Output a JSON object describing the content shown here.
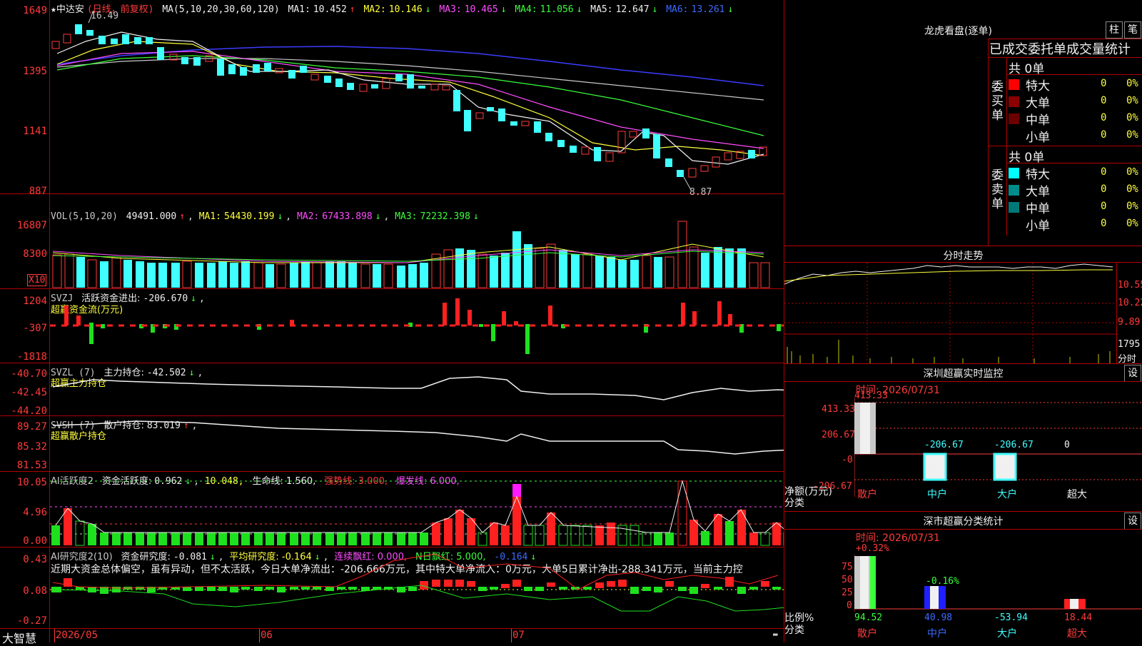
{
  "main_chart": {
    "title": "★中达安",
    "period": "(日线，前复权)",
    "ma_label": "MA(5,10,20,30,60,120)",
    "ma": [
      {
        "label": "MA1:",
        "value": "10.452",
        "arrow": "↑",
        "color": "#f0f0f0"
      },
      {
        "label": "MA2:",
        "value": "10.146",
        "arrow": "↓",
        "color": "#ffff3c"
      },
      {
        "label": "MA3:",
        "value": "10.465",
        "arrow": "↓",
        "color": "#ff4dff"
      },
      {
        "label": "MA4:",
        "value": "11.056",
        "arrow": "↓",
        "color": "#3cff3c"
      },
      {
        "label": "MA5:",
        "value": "12.647",
        "arrow": "↓",
        "color": "#f0f0f0"
      },
      {
        "label": "MA6:",
        "value": "13.261",
        "arrow": "↓",
        "color": "#3c6bff"
      }
    ],
    "y_ticks": [
      "1649",
      "1395",
      "1141",
      "887"
    ],
    "high_label": "16.49",
    "low_label": "8.87"
  },
  "vol_panel": {
    "label": "VOL(5,10,20)",
    "value": "49491.000",
    "ma": [
      {
        "label": "MA1:",
        "value": "54430.199",
        "arrow": "↓"
      },
      {
        "label": "MA2:",
        "value": "67433.898",
        "arrow": "↓"
      },
      {
        "label": "MA3:",
        "value": "72232.398",
        "arrow": "↓"
      }
    ],
    "y_ticks": [
      "16807",
      "8300"
    ],
    "unit": "X10"
  },
  "svzj_panel": {
    "label": "SVZJ",
    "name": "活跃资金进出:",
    "value": "-206.670",
    "sub": "超赢资金流(万元)",
    "y_ticks": [
      "1204",
      "-307",
      "-1818"
    ]
  },
  "svzl_panel": {
    "label": "SVZL (7)",
    "name": "主力持仓:",
    "value": "-42.502",
    "sub": "超赢主力持仓",
    "y_ticks": [
      "-40.70",
      "-42.45",
      "-44.20"
    ]
  },
  "svsh_panel": {
    "label": "SVSH (7)",
    "name": "散户持仓:",
    "value": "83.019",
    "sub": "超赢散户持仓",
    "y_ticks": [
      "89.27",
      "85.32",
      "81.53"
    ]
  },
  "ai_hy_panel": {
    "label": "AI活跃度2",
    "name": "资金活跃度:",
    "value1": "0.962",
    "value2": "10.048,",
    "life": "生命线: 1.560,",
    "strong": "强势线: 3.000,",
    "burst": "爆发线: 6.000,",
    "y_ticks": [
      "10.05",
      "4.96",
      "0.00"
    ]
  },
  "ai_yj_panel": {
    "label": "AI研究度2(10)",
    "name": "资金研究度:",
    "value": "-0.081",
    "avg": "平均研究度: -0.164",
    "red": "连续飘红: 0.000,",
    "nred": "N日飘红: 5.000,",
    "last": "-0.164",
    "comment": "近期大资金总体偏空，虽有异动，但不太活跃，今日大单净流出：-206.666万元，其中特大单净流入：0万元，大单5日累计净出-288.341万元，当前主力控",
    "y_ticks": [
      "0.43",
      "0.08",
      "-0.27"
    ]
  },
  "x_axis": {
    "brand": "大智慧",
    "labels": [
      "2026/05",
      "06",
      "07"
    ]
  },
  "longhu": {
    "title": "龙虎看盘(逐单)",
    "btn1": "柱",
    "btn2": "笔",
    "header": "已成交委托单成交量统计",
    "buy_label": "委买单",
    "sell_label": "委卖单",
    "buy_total": "共 0单",
    "sell_total": "共 0单",
    "buy_rows": [
      {
        "name": "特大",
        "num": "0",
        "pct": "0%",
        "color": "#ff0000"
      },
      {
        "name": "大单",
        "num": "0",
        "pct": "0%",
        "color": "#8b0000"
      },
      {
        "name": "中单",
        "num": "0",
        "pct": "0%",
        "color": "#6b0000"
      },
      {
        "name": "小单",
        "num": "0",
        "pct": "0%",
        "color": ""
      }
    ],
    "sell_rows": [
      {
        "name": "特大",
        "num": "0",
        "pct": "0%",
        "color": "#00ffff"
      },
      {
        "name": "大单",
        "num": "0",
        "pct": "0%",
        "color": "#008b8b"
      },
      {
        "name": "中单",
        "num": "0",
        "pct": "0%",
        "color": "#007878"
      },
      {
        "name": "小单",
        "num": "0",
        "pct": "0%",
        "color": ""
      }
    ]
  },
  "fenshi": {
    "title": "分时走势",
    "y_ticks": [
      "10.55",
      "10.22",
      "9.89",
      "1795"
    ],
    "unit": "分时"
  },
  "sz_monitor": {
    "title": "深圳超赢实时监控",
    "btn": "设",
    "time": "时间: 2026/07/31",
    "y_ticks": [
      "413.33",
      "206.67",
      "-0",
      "-206.67"
    ],
    "y_unit": "净额(万元)",
    "x_unit": "分类",
    "bars": [
      {
        "cat": "散户",
        "value": "413.33"
      },
      {
        "cat": "中户",
        "value": "-206.67"
      },
      {
        "cat": "大户",
        "value": "-206.67"
      },
      {
        "cat": "超大",
        "value": "0"
      }
    ]
  },
  "sz_class": {
    "title": "深市超赢分类统计",
    "btn": "设",
    "time": "时间: 2026/07/31",
    "y_ticks": [
      "75",
      "50",
      "25",
      "0"
    ],
    "y_unit": "比例%",
    "x_unit": "分类",
    "top_labels": [
      "+0.32%",
      "-0.16%"
    ],
    "bars": [
      {
        "cat": "散户",
        "value": "94.52"
      },
      {
        "cat": "中户",
        "value": "40.98"
      },
      {
        "cat": "大户",
        "value": "-53.94"
      },
      {
        "cat": "超大",
        "value": "18.44"
      }
    ]
  }
}
